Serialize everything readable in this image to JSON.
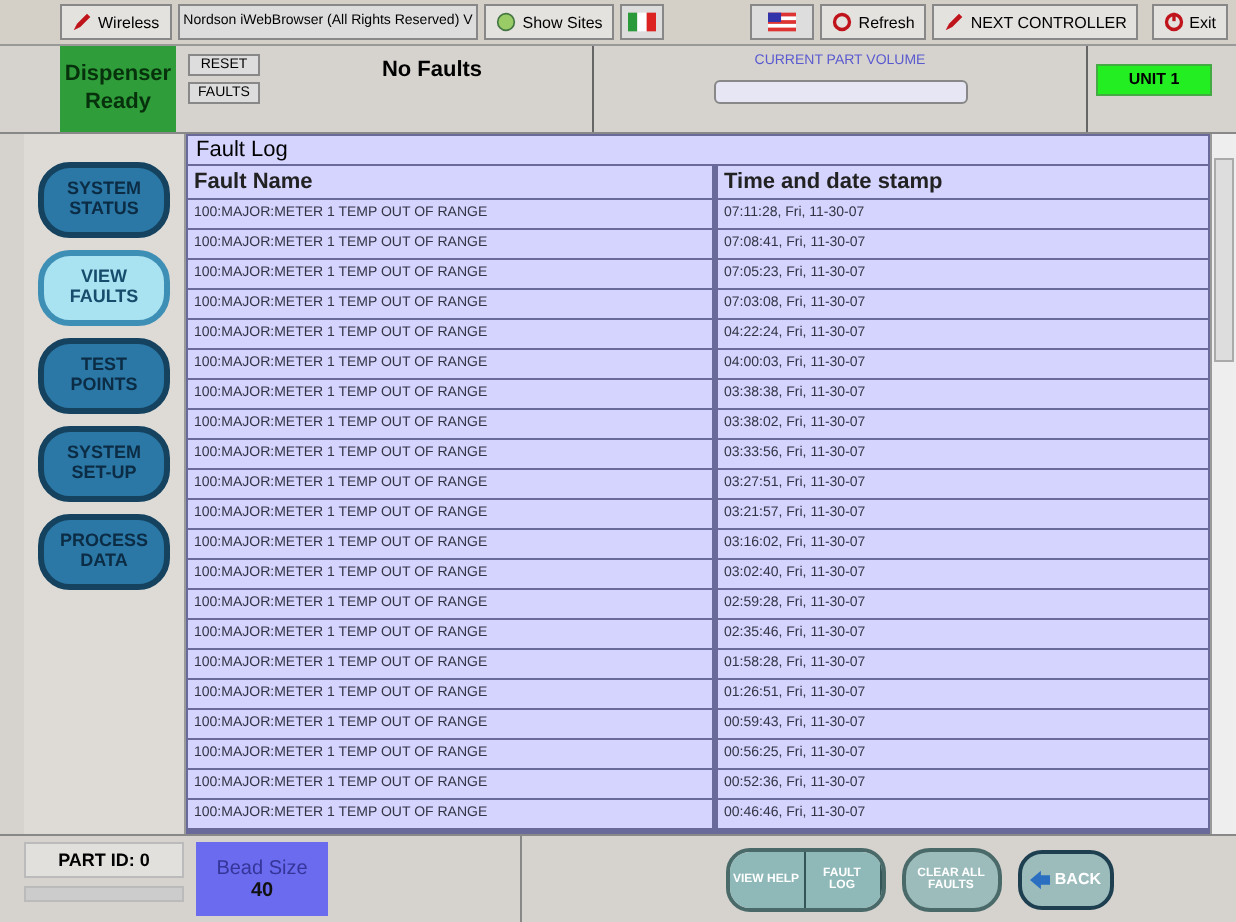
{
  "toolbar": {
    "items": [
      {
        "kind": "pen",
        "label": "Wireless"
      },
      {
        "kind": "title",
        "label": "Nordson iWebBrowser (All Rights Reserved) V"
      },
      {
        "kind": "sites",
        "label": "Show Sites"
      },
      {
        "kind": "flag-it"
      },
      {
        "kind": "flag-us"
      },
      {
        "kind": "refresh",
        "label": "Refresh"
      },
      {
        "kind": "pen",
        "label": "NEXT CONTROLLER"
      },
      {
        "kind": "exit",
        "label": "Exit"
      }
    ]
  },
  "header": {
    "status": "Dispenser Ready",
    "reset_buttons": [
      "RESET",
      "FAULTS"
    ],
    "fault_message": "No Faults",
    "volume_label": "CURRENT PART VOLUME",
    "unit": "UNIT 1"
  },
  "sidebar": {
    "items": [
      {
        "label": "SYSTEM STATUS",
        "selected": false
      },
      {
        "label": "VIEW FAULTS",
        "selected": true
      },
      {
        "label": "TEST POINTS",
        "selected": false
      },
      {
        "label": "SYSTEM SET-UP",
        "selected": false
      },
      {
        "label": "PROCESS DATA",
        "selected": false
      }
    ]
  },
  "fault_log": {
    "title": "Fault Log",
    "columns": [
      "Fault Name",
      "Time and date stamp"
    ],
    "rows": [
      [
        "100:MAJOR:METER 1 TEMP OUT OF RANGE",
        "07:11:28, Fri, 11-30-07"
      ],
      [
        "100:MAJOR:METER 1 TEMP OUT OF RANGE",
        "07:08:41, Fri, 11-30-07"
      ],
      [
        "100:MAJOR:METER 1 TEMP OUT OF RANGE",
        "07:05:23, Fri, 11-30-07"
      ],
      [
        "100:MAJOR:METER 1 TEMP OUT OF RANGE",
        "07:03:08, Fri, 11-30-07"
      ],
      [
        "100:MAJOR:METER 1 TEMP OUT OF RANGE",
        "04:22:24, Fri, 11-30-07"
      ],
      [
        "100:MAJOR:METER 1 TEMP OUT OF RANGE",
        "04:00:03, Fri, 11-30-07"
      ],
      [
        "100:MAJOR:METER 1 TEMP OUT OF RANGE",
        "03:38:38, Fri, 11-30-07"
      ],
      [
        "100:MAJOR:METER 1 TEMP OUT OF RANGE",
        "03:38:02, Fri, 11-30-07"
      ],
      [
        "100:MAJOR:METER 1 TEMP OUT OF RANGE",
        "03:33:56, Fri, 11-30-07"
      ],
      [
        "100:MAJOR:METER 1 TEMP OUT OF RANGE",
        "03:27:51, Fri, 11-30-07"
      ],
      [
        "100:MAJOR:METER 1 TEMP OUT OF RANGE",
        "03:21:57, Fri, 11-30-07"
      ],
      [
        "100:MAJOR:METER 1 TEMP OUT OF RANGE",
        "03:16:02, Fri, 11-30-07"
      ],
      [
        "100:MAJOR:METER 1 TEMP OUT OF RANGE",
        "03:02:40, Fri, 11-30-07"
      ],
      [
        "100:MAJOR:METER 1 TEMP OUT OF RANGE",
        "02:59:28, Fri, 11-30-07"
      ],
      [
        "100:MAJOR:METER 1 TEMP OUT OF RANGE",
        "02:35:46, Fri, 11-30-07"
      ],
      [
        "100:MAJOR:METER 1 TEMP OUT OF RANGE",
        "01:58:28, Fri, 11-30-07"
      ],
      [
        "100:MAJOR:METER 1 TEMP OUT OF RANGE",
        "01:26:51, Fri, 11-30-07"
      ],
      [
        "100:MAJOR:METER 1 TEMP OUT OF RANGE",
        "00:59:43, Fri, 11-30-07"
      ],
      [
        "100:MAJOR:METER 1 TEMP OUT OF RANGE",
        "00:56:25, Fri, 11-30-07"
      ],
      [
        "100:MAJOR:METER 1 TEMP OUT OF RANGE",
        "00:52:36, Fri, 11-30-07"
      ],
      [
        "100:MAJOR:METER 1 TEMP OUT OF RANGE",
        "00:46:46, Fri, 11-30-07"
      ]
    ]
  },
  "footer": {
    "part_id": "PART ID: 0",
    "bead_label": "Bead Size",
    "bead_value": "40",
    "buttons": [
      {
        "kind": "pill",
        "label": "VIEW HELP"
      },
      {
        "kind": "pill",
        "label": "FAULT LOG"
      },
      {
        "kind": "round",
        "label": "CLEAR ALL FAULTS"
      },
      {
        "kind": "back",
        "label": "BACK"
      }
    ]
  }
}
